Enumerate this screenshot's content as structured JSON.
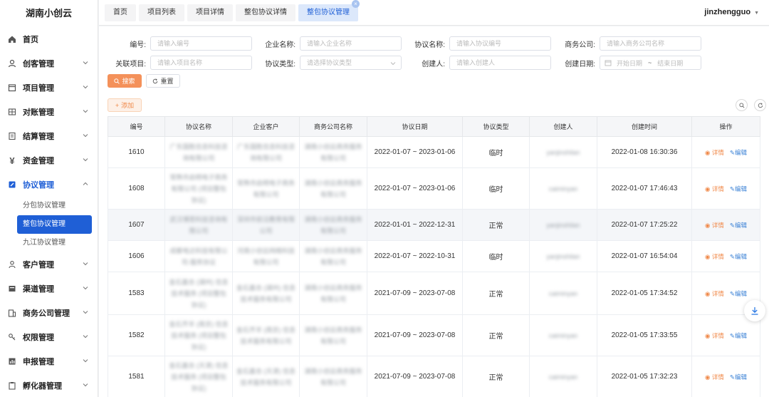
{
  "app": {
    "brand": "湖南小创云",
    "user": "jinzhengguo"
  },
  "tabs": [
    {
      "label": "首页"
    },
    {
      "label": "项目列表"
    },
    {
      "label": "项目详情"
    },
    {
      "label": "整包协议详情"
    },
    {
      "label": "整包协议管理",
      "close": "×"
    }
  ],
  "sidebar": {
    "items": [
      {
        "label": "首页"
      },
      {
        "label": "创客管理"
      },
      {
        "label": "项目管理"
      },
      {
        "label": "对账管理"
      },
      {
        "label": "结算管理"
      },
      {
        "label": "资金管理"
      },
      {
        "label": "协议管理"
      },
      {
        "label": "客户管理"
      },
      {
        "label": "渠道管理"
      },
      {
        "label": "商务公司管理"
      },
      {
        "label": "权限管理"
      },
      {
        "label": "申报管理"
      },
      {
        "label": "孵化器管理"
      }
    ],
    "sub_items": [
      {
        "label": "分包协议管理"
      },
      {
        "label": "整包协议管理"
      },
      {
        "label": "九江协议管理"
      }
    ]
  },
  "filters": {
    "number": {
      "label": "编号:",
      "placeholder": "请输入编号"
    },
    "company": {
      "label": "企业名称:",
      "placeholder": "请输入企业名称"
    },
    "agreement_name": {
      "label": "协议名称:",
      "placeholder": "请输入协议编号"
    },
    "business_company": {
      "label": "商务公司:",
      "placeholder": "请输入商务公司名称"
    },
    "project": {
      "label": "关联项目:",
      "placeholder": "请输入项目名称"
    },
    "agreement_type": {
      "label": "协议类型:",
      "placeholder": "请选择协议类型"
    },
    "creator": {
      "label": "创建人:",
      "placeholder": "请输入创建人"
    },
    "create_date": {
      "label": "创建日期:",
      "start": "开始日期",
      "sep": "~",
      "end": "结束日期"
    }
  },
  "buttons": {
    "search": "搜索",
    "reset": "重置",
    "add": "添加"
  },
  "table": {
    "headers": [
      "编号",
      "协议名称",
      "企业客户",
      "商务公司名称",
      "协议日期",
      "协议类型",
      "创建人",
      "创建时间",
      "操作"
    ],
    "actions": {
      "detail": "详情",
      "edit": "编辑"
    },
    "rows": [
      {
        "id": "1610",
        "name": "广东国胜信息科技咨询有限公司",
        "client": "广东国胜信息科技咨询有限公司",
        "biz": "湖南小创云商务服务有限公司",
        "date": "2022-01-07 ~ 2023-01-06",
        "type": "临时",
        "creator": "yanjinshilan",
        "created": "2022-01-08 16:30:36"
      },
      {
        "id": "1608",
        "name": "常熟市启明电子商务有限公司 (项目整包协议)",
        "client": "常熟市启明电子商务有限公司",
        "biz": "湖南小创云商务服务有限公司",
        "date": "2022-01-07 ~ 2023-01-06",
        "type": "临时",
        "creator": "caiminyan",
        "created": "2022-01-07 17:46:43"
      },
      {
        "id": "1607",
        "name": "武汉博思科技咨询有限公司",
        "client": "深圳市前沿教育有限公司",
        "biz": "湖南小创云商务服务有限公司",
        "date": "2022-01-01 ~ 2022-12-31",
        "type": "正常",
        "creator": "yanjinshilan",
        "created": "2022-01-07 17:25:22"
      },
      {
        "id": "1606",
        "name": "成都电达科技有限公司-服务协议",
        "client": "河南小创云网络科技有限公司",
        "biz": "湖南小创云商务服务有限公司",
        "date": "2022-01-07 ~ 2022-10-31",
        "type": "临时",
        "creator": "yanjinshilan",
        "created": "2022-01-07 16:54:04"
      },
      {
        "id": "1583",
        "name": "金石嘉合 (湖州) 信息技术服务 (项目整包协议)",
        "client": "金石嘉合 (湖州) 信息技术服务有限公司",
        "biz": "湖南小创云商务服务有限公司",
        "date": "2021-07-09 ~ 2023-07-08",
        "type": "正常",
        "creator": "caiminyan",
        "created": "2022-01-05 17:34:52"
      },
      {
        "id": "1582",
        "name": "金石齐羊 (南京) 信息技术服务 (项目整包协议)",
        "client": "金石齐羊 (南京) 信息技术服务有限公司",
        "biz": "湖南小创云商务服务有限公司",
        "date": "2021-07-09 ~ 2023-07-08",
        "type": "正常",
        "creator": "caiminyan",
        "created": "2022-01-05 17:33:55"
      },
      {
        "id": "1581",
        "name": "金石嘉合 (天津) 信息技术服务 (项目整包协议)",
        "client": "金石嘉合 (天津) 信息技术服务有限公司",
        "biz": "湖南小创云商务服务有限公司",
        "date": "2021-07-09 ~ 2023-07-08",
        "type": "正常",
        "creator": "caiminyan",
        "created": "2022-01-05 17:32:23"
      }
    ]
  },
  "colors": {
    "primary": "#1f5fd6",
    "accent": "#f4915a",
    "link": "#3b82d6"
  }
}
